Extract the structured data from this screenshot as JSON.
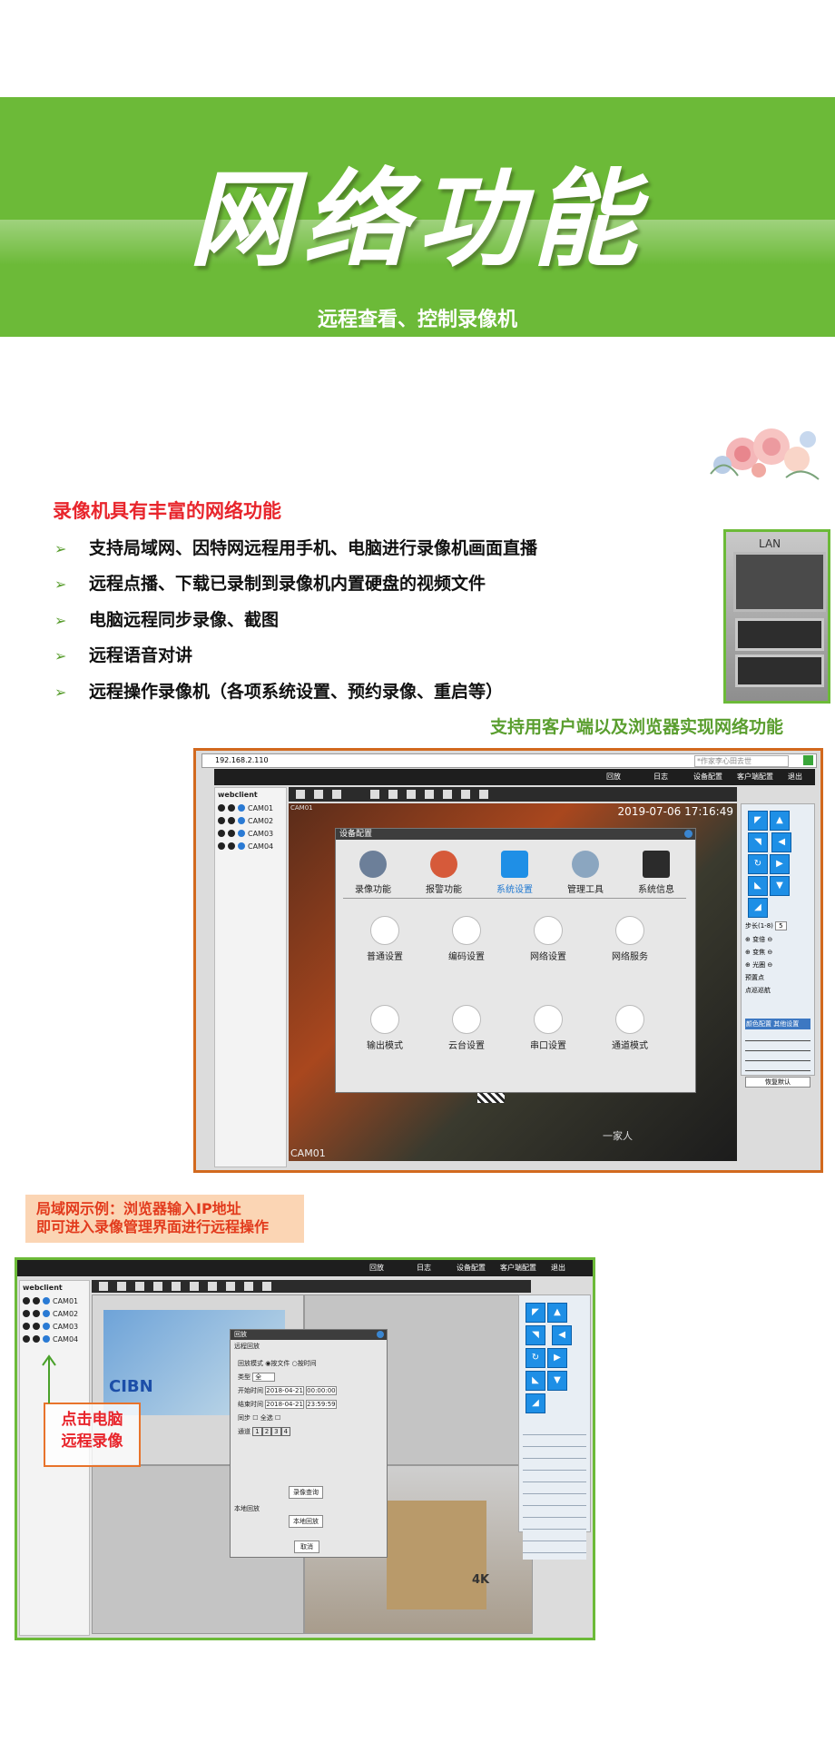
{
  "banner": {
    "title": "网络功能",
    "subtitle": "远程查看、控制录像机"
  },
  "features": {
    "heading": "录像机具有丰富的网络功能",
    "items": [
      "支持局域网、因特网远程用手机、电脑进行录像机画面直播",
      "远程点播、下载已录制到录像机内置硬盘的视频文件",
      "电脑远程同步录像、截图",
      "远程语音对讲",
      "远程操作录像机（各项系统设置、预约录像、重启等）"
    ],
    "support_line": "支持用客户端以及浏览器实现网络功能"
  },
  "lan_photo": {
    "label": "LAN"
  },
  "shot1": {
    "address": "192.168.2.110",
    "search_placeholder": "*作家李心田去世",
    "tabs": [
      "回放",
      "日志",
      "设备配置",
      "客户端配置",
      "退出"
    ],
    "client_name": "webclient",
    "cameras": [
      "CAM01",
      "CAM02",
      "CAM03",
      "CAM04"
    ],
    "video_label_top": "CAM01",
    "video_label_bottom": "CAM01",
    "timestamp": "2019-07-06 17:16:49",
    "dialog": {
      "title": "设备配置",
      "tabs": [
        "录像功能",
        "报警功能",
        "系统设置",
        "管理工具",
        "系统信息"
      ],
      "items": [
        "普通设置",
        "编码设置",
        "网络设置",
        "网络服务",
        "输出模式",
        "云台设置",
        "串口设置",
        "通道模式"
      ]
    },
    "ptz": {
      "step_label": "步长(1-8)",
      "step_value": "5",
      "zoom": "变倍",
      "focus": "变焦",
      "iris": "光圈",
      "preset": "预置点",
      "cruise": "点巡巡航",
      "color_tab": "颜色配置",
      "other_tab": "其他设置",
      "default_btn": "恢复默认"
    },
    "overlay_text": "一家人"
  },
  "lan_note": {
    "line1": "局域网示例：浏览器输入IP地址",
    "line2": "即可进入录像管理界面进行远程操作"
  },
  "shot2": {
    "tabs": [
      "回放",
      "日志",
      "设备配置",
      "客户端配置",
      "退出"
    ],
    "client_name": "webclient",
    "cameras": [
      "CAM01",
      "CAM02",
      "CAM03",
      "CAM04"
    ],
    "dialog": {
      "title": "回放",
      "section": "远程回放",
      "mode_label": "回放模式",
      "mode_opt1": "按文件",
      "mode_opt2": "按时间",
      "type_label": "类型",
      "type_value": "全",
      "start_label": "开始时间",
      "start_date": "2018-04-21",
      "start_time": "00:00:00",
      "end_label": "结束时间",
      "end_date": "2018-04-21",
      "end_time": "23:59:59",
      "sync_label": "同步",
      "all_label": "全选",
      "channel_label": "通道",
      "channels": [
        "1",
        "2",
        "3",
        "4"
      ],
      "query_btn": "录像查询",
      "local_section": "本地回放",
      "local_btn": "本地回放",
      "cancel_btn": "取消"
    },
    "tv_brand": "CIBN",
    "box_brand": "4K"
  },
  "callout": {
    "line1": "点击电脑",
    "line2": "远程录像"
  },
  "colors": {
    "banner_green": "#6cba38",
    "heading_red": "#e8252c",
    "accent_green": "#5a9e2f",
    "shot1_border": "#d2691e",
    "note_bg": "#fbd5b4"
  }
}
